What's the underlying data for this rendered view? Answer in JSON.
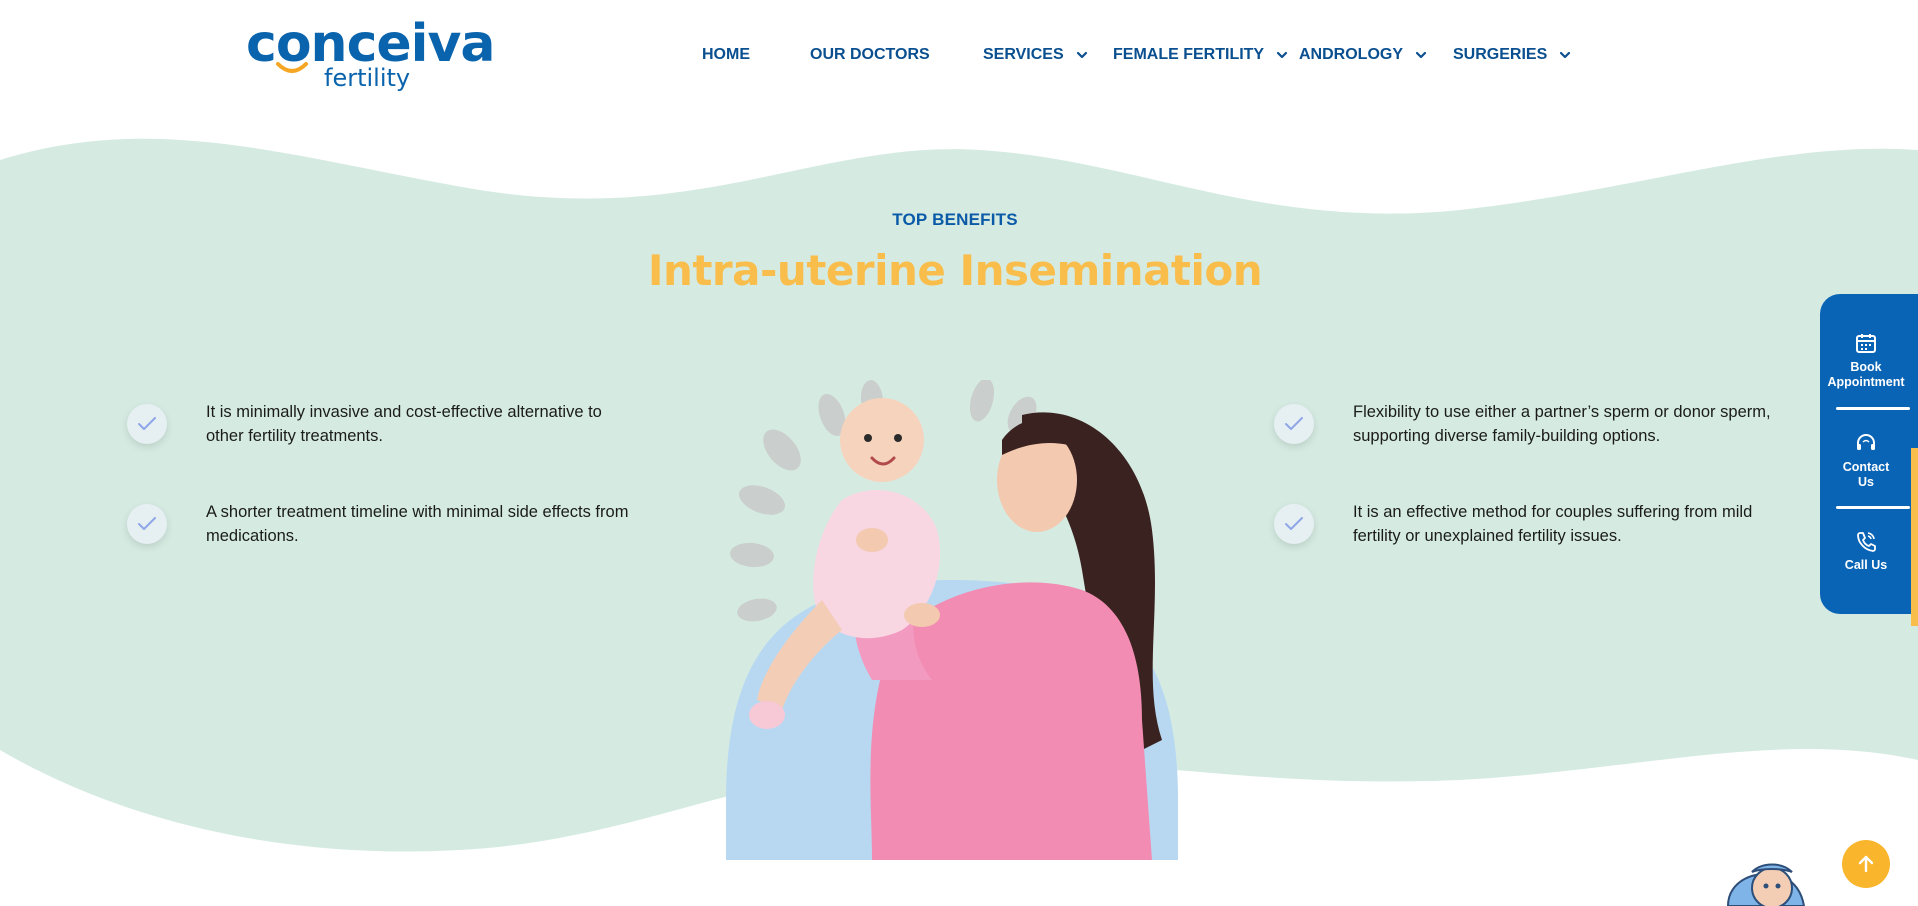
{
  "brand": {
    "name": "conceiva",
    "tagline": "fertility",
    "primary_color": "#0a64ad",
    "accent_color": "#f9bd4b",
    "section_bg": "#d5ebe2"
  },
  "nav": {
    "items": [
      {
        "label": "HOME",
        "has_dropdown": false
      },
      {
        "label": "OUR DOCTORS",
        "has_dropdown": false
      },
      {
        "label": "SERVICES",
        "has_dropdown": true
      },
      {
        "label": "FEMALE FERTILITY",
        "has_dropdown": true
      },
      {
        "label": "ANDROLOGY",
        "has_dropdown": true
      },
      {
        "label": "SURGERIES",
        "has_dropdown": true
      }
    ]
  },
  "section": {
    "eyebrow": "TOP BENEFITS",
    "title": "Intra-uterine Insemination",
    "benefits_left": [
      {
        "text": "It is minimally invasive and cost-effective alternative to other fertility treatments."
      },
      {
        "text": "A shorter treatment timeline with minimal side effects from medications."
      }
    ],
    "benefits_right": [
      {
        "text": "Flexibility to use either a partner’s sperm or donor sperm, supporting diverse family-building options."
      },
      {
        "text": "It is an effective method for couples suffering from mild fertility or unexplained fertility issues."
      }
    ],
    "icons": {
      "benefit": "check-icon",
      "hero": "mother-holding-baby-image"
    }
  },
  "sidebar": {
    "items": [
      {
        "label_line1": "Book",
        "label_line2": "Appointment",
        "icon": "calendar-icon"
      },
      {
        "label_line1": "Contact",
        "label_line2": "Us",
        "icon": "headset-icon"
      },
      {
        "label_line1": "Call Us",
        "label_line2": "",
        "icon": "phone-icon"
      }
    ]
  },
  "scroll_top": {
    "icon": "arrow-up-icon"
  }
}
